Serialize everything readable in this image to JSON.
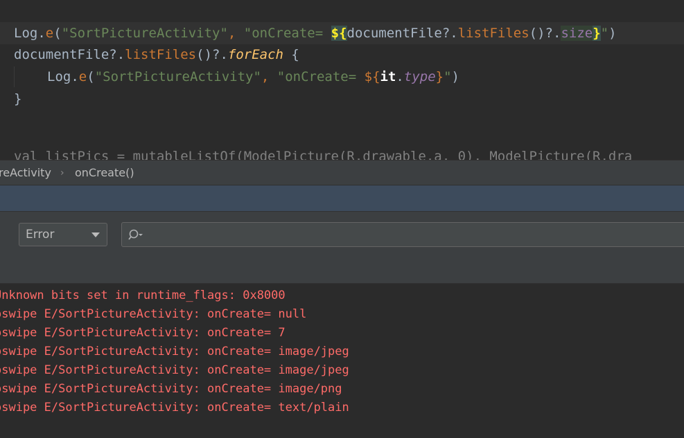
{
  "editor": {
    "line1": {
      "log": "Log",
      "dot": ".",
      "fn": "e",
      "open": "(",
      "tag": "\"SortPictureActivity\"",
      "comma": ", ",
      "msg_prefix": "\"onCreate= ",
      "template_open": "${",
      "receiver": "documentFile",
      "op1": "?.",
      "call": "listFiles",
      "parens": "()",
      "op2": "?.",
      "prop": "size",
      "template_close": "}",
      "msg_end": "\"",
      "close": ")"
    },
    "line2": {
      "receiver": "documentFile",
      "op1": "?.",
      "call": "listFiles",
      "parens": "()",
      "op2": "?.",
      "ext": "forEach",
      "brace": " {"
    },
    "line3": {
      "log": "Log",
      "dot": ".",
      "fn": "e",
      "open": "(",
      "tag": "\"SortPictureActivity\"",
      "comma": ", ",
      "msg_prefix": "\"onCreate= ",
      "template_open": "${",
      "it": "it",
      "dot2": ".",
      "prop": "type",
      "template_close": "}",
      "msg_end": "\"",
      "close": ")"
    },
    "line4": {
      "brace": "}"
    },
    "line5_partial": "val listPics = mutableListOf(ModelPicture(R.drawable.a, 0), ModelPicture(R.dra"
  },
  "breadcrumb": {
    "class_name": "reActivity",
    "separator": "›",
    "method": "onCreate()"
  },
  "logcat": {
    "level_value": "Error",
    "search_value": "",
    "search_placeholder": "",
    "lines": [
      "Unknown bits set in runtime_flags: 0x8000",
      "oswipe E/SortPictureActivity: onCreate= null",
      "oswipe E/SortPictureActivity: onCreate= 7",
      "oswipe E/SortPictureActivity: onCreate= image/jpeg",
      "oswipe E/SortPictureActivity: onCreate= image/jpeg",
      "oswipe E/SortPictureActivity: onCreate= image/png",
      "oswipe E/SortPictureActivity: onCreate= text/plain"
    ]
  },
  "colors": {
    "editor_bg": "#2b2b2b",
    "panel_bg": "#3c3f41",
    "tool_strip_bg": "#3d4b5c",
    "log_error": "#ff6b68",
    "string": "#6a8759",
    "method_call": "#cc7832",
    "brace_match": "#ffef28"
  }
}
